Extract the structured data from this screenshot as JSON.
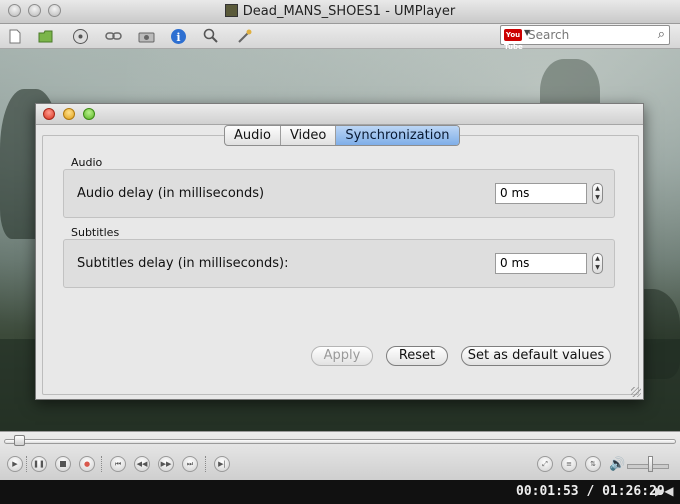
{
  "window": {
    "title": "Dead_MANS_SHOES1 - UMPlayer"
  },
  "toolbar": {
    "icons": [
      "new-file-icon",
      "open-folder-icon",
      "dvd-icon",
      "link-icon",
      "camera-icon",
      "info-icon",
      "search-magnifier-icon",
      "tools-icon"
    ],
    "search_placeholder": "Search",
    "youtube_badge": "You Tube"
  },
  "dialog": {
    "tabs": [
      {
        "label": "Audio",
        "active": false
      },
      {
        "label": "Video",
        "active": false
      },
      {
        "label": "Synchronization",
        "active": true
      }
    ],
    "audio_group": {
      "title": "Audio",
      "field_label": "Audio delay (in milliseconds)",
      "value": "0 ms"
    },
    "subtitles_group": {
      "title": "Subtitles",
      "field_label": "Subtitles delay (in milliseconds):",
      "value": "0 ms"
    },
    "buttons": {
      "apply": "Apply",
      "reset": "Reset",
      "default": "Set as default values"
    }
  },
  "player": {
    "time_current": "00:01:53",
    "time_separator": " / ",
    "time_total": "01:26:29",
    "accent_color": "#7faee8"
  }
}
